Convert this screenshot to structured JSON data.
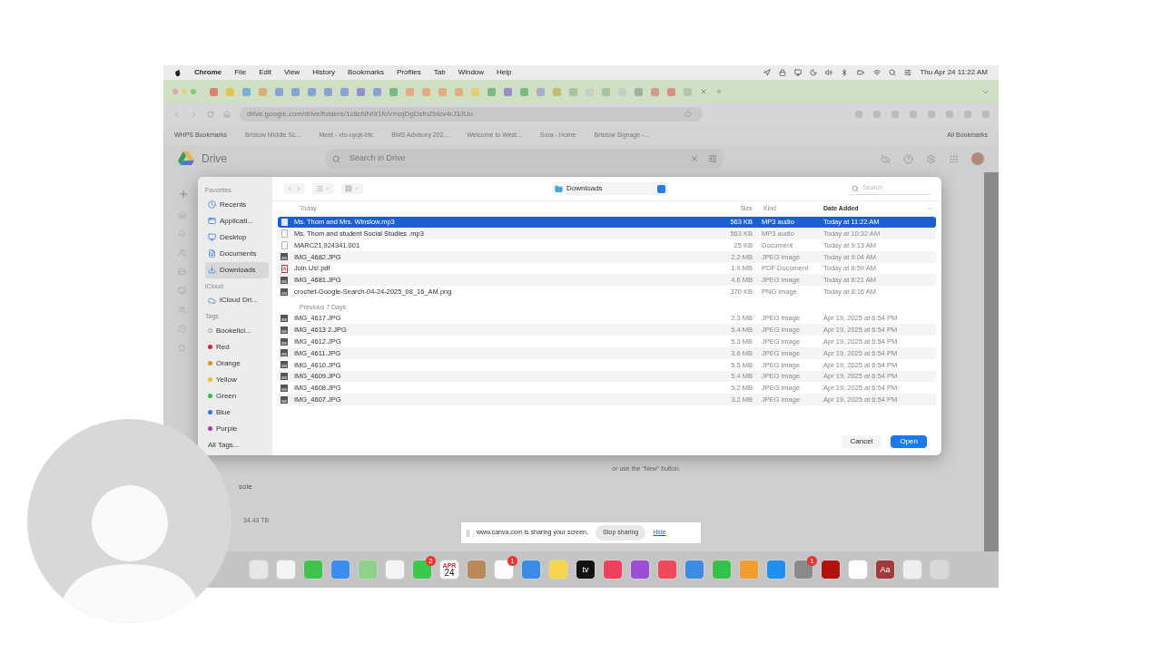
{
  "menu_bar": {
    "app": "Chrome",
    "menus": [
      "File",
      "Edit",
      "View",
      "History",
      "Bookmarks",
      "Profiles",
      "Tab",
      "Window",
      "Help"
    ],
    "clock": "Thu Apr 24 11:22 AM"
  },
  "address_bar": {
    "url": "drive.google.com/drive/folders/1c8cNN0I1foVmojDgDsfnZblcv4rJ3JUu"
  },
  "bookmarks": [
    "WHPS Bookmarks",
    "Bristow Middle Sc...",
    "Meet - vto-uyqk-bfc",
    "BMS Advisory 202...",
    "Welcome to West...",
    "Sora - Home",
    "Bristow Signage -...",
    "All Bookmarks"
  ],
  "drive": {
    "title": "Drive",
    "search_placeholder": "Search in Drive",
    "empty_hint": "or use the \"New\" button.",
    "storage_label": "sole",
    "storage_used": "34.43 TB"
  },
  "dialog": {
    "location": "Downloads",
    "search_placeholder": "Search",
    "columns": [
      "Size",
      "Kind",
      "Date Added"
    ],
    "sidebar": [
      {
        "heading": "Favorites",
        "items": [
          {
            "label": "Recents",
            "selected": false
          },
          {
            "label": "Applicati...",
            "selected": false
          },
          {
            "label": "Desktop",
            "selected": false
          },
          {
            "label": "Documents",
            "selected": false
          },
          {
            "label": "Downloads",
            "selected": true
          }
        ]
      },
      {
        "heading": "iCloud",
        "items": [
          {
            "label": "iCloud Dri...",
            "selected": false
          }
        ]
      },
      {
        "heading": "Tags",
        "items": [
          {
            "label": "Bookelici...",
            "selected": false
          },
          {
            "label": "Red",
            "selected": false,
            "color": "#e0202a"
          },
          {
            "label": "Orange",
            "selected": false,
            "color": "#e88a1c"
          },
          {
            "label": "Yellow",
            "selected": false,
            "color": "#f0c020"
          },
          {
            "label": "Green",
            "selected": false,
            "color": "#2cc03a"
          },
          {
            "label": "Blue",
            "selected": false,
            "color": "#2a7ae8"
          },
          {
            "label": "Purple",
            "selected": false,
            "color": "#a43ad0"
          },
          {
            "label": "All Tags...",
            "selected": false
          }
        ]
      }
    ],
    "sections": [
      {
        "label": "Today",
        "files": [
          {
            "name": "Ms. Thom and Mrs. Winslow.mp3",
            "size": "563 KB",
            "file_kind": "MP3 audio",
            "date": "Today at 11:22 AM",
            "kind": "audio",
            "selected": true
          },
          {
            "name": "Ms. Thom and student Social Studies .mp3",
            "size": "563 KB",
            "file_kind": "MP3 audio",
            "date": "Today at 10:32 AM",
            "kind": "audio",
            "selected": false
          },
          {
            "name": "MARC21.924341.001",
            "size": "25 KB",
            "file_kind": "Document",
            "date": "Today at 9:13 AM",
            "kind": "doc",
            "selected": false
          },
          {
            "name": "IMG_4682.JPG",
            "size": "2.2 MB",
            "file_kind": "JPEG image",
            "date": "Today at 9:04 AM",
            "kind": "image",
            "selected": false
          },
          {
            "name": "Join Us!.pdf",
            "size": "1.9 MB",
            "file_kind": "PDF Document",
            "date": "Today at 8:59 AM",
            "kind": "pdf",
            "selected": false
          },
          {
            "name": "IMG_4681.JPG",
            "size": "4.6 MB",
            "file_kind": "JPEG image",
            "date": "Today at 8:21 AM",
            "kind": "image",
            "selected": false
          },
          {
            "name": "crochet-Google-Search-04-24-2025_08_16_AM.png",
            "size": "370 KB",
            "file_kind": "PNG image",
            "date": "Today at 8:16 AM",
            "kind": "image",
            "selected": false
          }
        ]
      },
      {
        "label": "Previous 7 Days",
        "files": [
          {
            "name": "IMG_4617.JPG",
            "size": "2.3 MB",
            "file_kind": "JPEG image",
            "date": "Apr 19, 2025 at 6:54 PM",
            "kind": "image",
            "selected": false
          },
          {
            "name": "IMG_4613 2.JPG",
            "size": "5.4 MB",
            "file_kind": "JPEG image",
            "date": "Apr 19, 2025 at 6:54 PM",
            "kind": "image",
            "selected": false
          },
          {
            "name": "IMG_4612.JPG",
            "size": "5.3 MB",
            "file_kind": "JPEG image",
            "date": "Apr 19, 2025 at 6:54 PM",
            "kind": "image",
            "selected": false
          },
          {
            "name": "IMG_4611.JPG",
            "size": "3.6 MB",
            "file_kind": "JPEG image",
            "date": "Apr 19, 2025 at 6:54 PM",
            "kind": "image",
            "selected": false
          },
          {
            "name": "IMG_4610.JPG",
            "size": "5.5 MB",
            "file_kind": "JPEG image",
            "date": "Apr 19, 2025 at 6:54 PM",
            "kind": "image",
            "selected": false
          },
          {
            "name": "IMG_4609.JPG",
            "size": "5.4 MB",
            "file_kind": "JPEG image",
            "date": "Apr 19, 2025 at 6:54 PM",
            "kind": "image",
            "selected": false
          },
          {
            "name": "IMG_4608.JPG",
            "size": "5.2 MB",
            "file_kind": "JPEG image",
            "date": "Apr 19, 2025 at 6:54 PM",
            "kind": "image",
            "selected": false
          },
          {
            "name": "IMG_4607.JPG",
            "size": "3.2 MB",
            "file_kind": "JPEG image",
            "date": "Apr 19, 2025 at 6:54 PM",
            "kind": "image",
            "selected": false
          }
        ]
      }
    ],
    "buttons": [
      {
        "label": "Cancel",
        "kind": "secondary"
      },
      {
        "label": "Open",
        "kind": "primary"
      }
    ]
  },
  "share_bar": {
    "message": "www.canva.com is sharing your screen.",
    "stop": "Stop sharing",
    "hide": "Hide"
  },
  "dock": [
    {
      "color": "#e6e6e6"
    },
    {
      "color": "#f4f4f4"
    },
    {
      "color": "#3dc54a"
    },
    {
      "color": "#3b8df0"
    },
    {
      "color": "#8fd08a"
    },
    {
      "color": "#f4f4f4"
    },
    {
      "color": "#3cc84a",
      "badge": "2"
    },
    {
      "color": "#ffffff",
      "labels": [
        "APR",
        "24"
      ]
    },
    {
      "color": "#b8895a"
    },
    {
      "color": "#ffffff",
      "badge": "1"
    },
    {
      "color": "#3a8de6"
    },
    {
      "color": "#f5d64b"
    },
    {
      "color": "#111111",
      "labels": [
        "tv"
      ]
    },
    {
      "color": "#f2405a"
    },
    {
      "color": "#9b4fd6"
    },
    {
      "color": "#f04a5a"
    },
    {
      "color": "#3c8ce6"
    },
    {
      "color": "#35c24a"
    },
    {
      "color": "#f29d2e"
    },
    {
      "color": "#1f8ff0"
    },
    {
      "color": "#8a8a8a",
      "badge": "1"
    },
    {
      "color": "#b3110f"
    },
    {
      "color": "#ffffff"
    },
    {
      "color": "#a33a3a",
      "labels": [
        "Aa"
      ]
    },
    {
      "color": "#eeeeee"
    },
    {
      "color": "#d8d8d8"
    }
  ]
}
